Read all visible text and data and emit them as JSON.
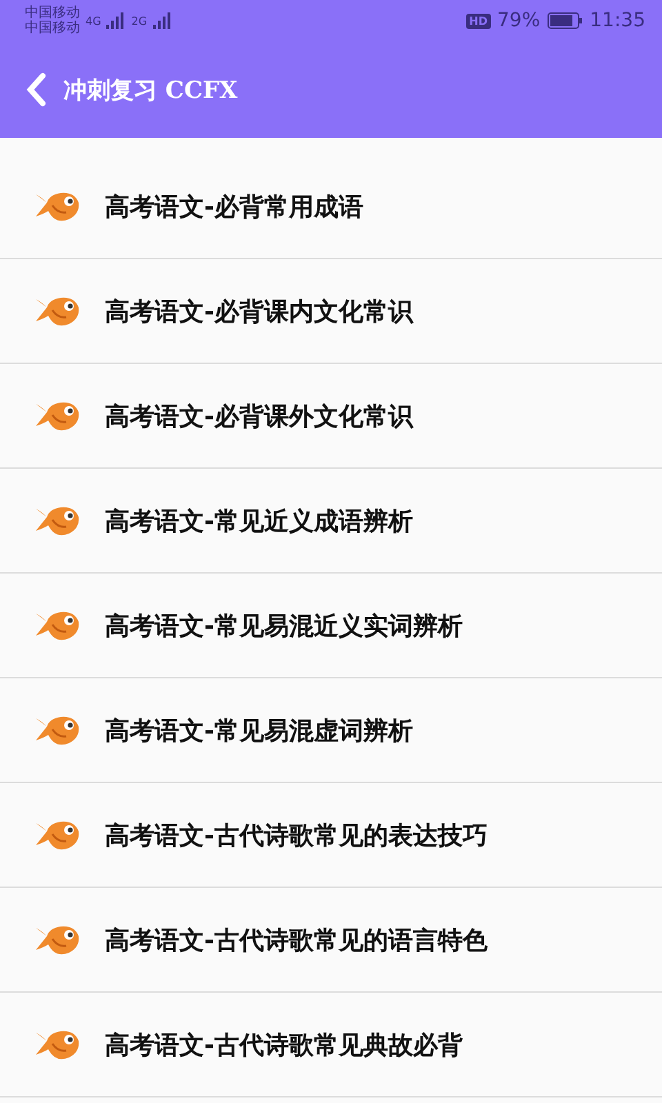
{
  "status_bar": {
    "carriers": [
      "中国移动",
      "中国移动"
    ],
    "networks": [
      "4G",
      "2G"
    ],
    "hd": "HD",
    "battery": "79%",
    "time": "11:35"
  },
  "header": {
    "title": "冲刺复习 CCFX"
  },
  "items": [
    {
      "label": "高考语文-必背常用成语"
    },
    {
      "label": "高考语文-必背课内文化常识"
    },
    {
      "label": "高考语文-必背课外文化常识"
    },
    {
      "label": "高考语文-常见近义成语辨析"
    },
    {
      "label": "高考语文-常见易混近义实词辨析"
    },
    {
      "label": "高考语文-常见易混虚词辨析"
    },
    {
      "label": "高考语文-古代诗歌常见的表达技巧"
    },
    {
      "label": "高考语文-古代诗歌常见的语言特色"
    },
    {
      "label": "高考语文-古代诗歌常见典故必背"
    }
  ]
}
